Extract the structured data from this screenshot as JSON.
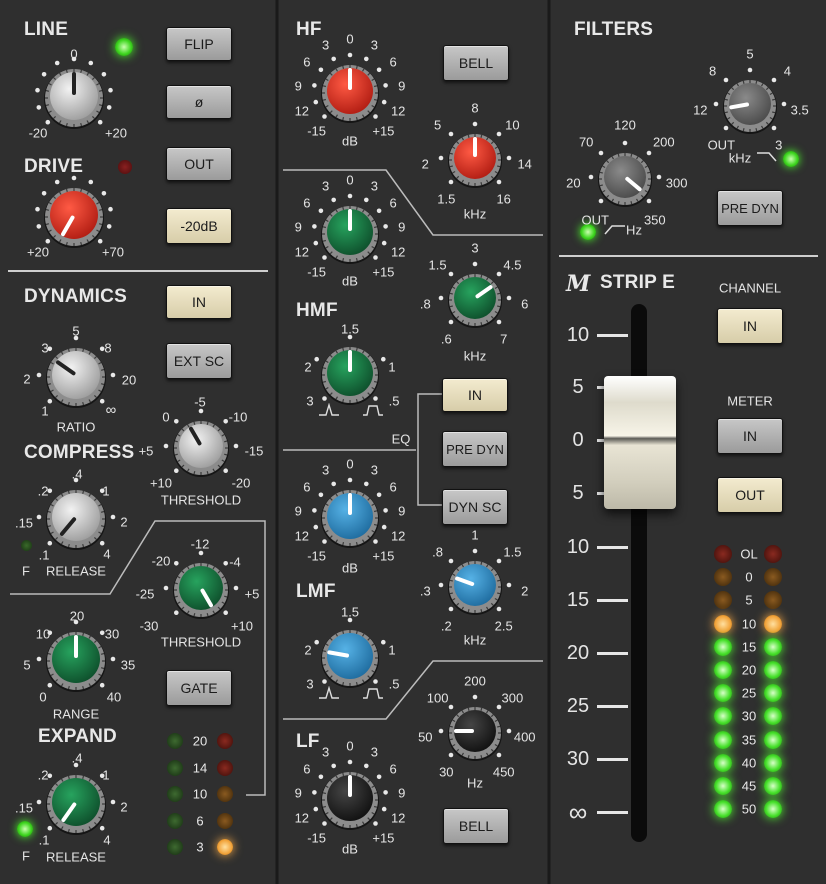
{
  "line": {
    "title": "LINE",
    "buttons": {
      "flip": "FLIP",
      "phase": "ø"
    },
    "knob_scale": {
      "top": "0",
      "left": "-20",
      "right": "+20"
    }
  },
  "drive": {
    "title": "DRIVE",
    "buttons": {
      "out": "OUT",
      "pad": "-20dB"
    },
    "knob_scale": {
      "left": "+20",
      "right": "+70"
    }
  },
  "dynamics": {
    "title": "DYNAMICS",
    "in_button": "IN",
    "ext_sc_button": "EXT SC",
    "ratio": {
      "label": "RATIO",
      "scale": [
        "1",
        "2",
        "3",
        "5",
        "8",
        "20",
        "∞"
      ]
    },
    "compress": {
      "title": "COMPRESS"
    },
    "comp_threshold": {
      "label": "THRESHOLD",
      "scale": [
        "+10",
        "+5",
        "0",
        "-5",
        "-10",
        "-15",
        "-20"
      ]
    },
    "comp_release": {
      "label": "RELEASE",
      "scale": [
        ".1",
        ".15",
        ".2",
        ".4",
        "1",
        "2",
        "4"
      ],
      "fast_label": "F"
    },
    "gate_threshold": {
      "label": "THRESHOLD",
      "scale": [
        "-30",
        "-25",
        "-20",
        "-12",
        "-4",
        "+5",
        "+10"
      ]
    },
    "range": {
      "label": "RANGE",
      "scale": [
        "0",
        "5",
        "10",
        "20",
        "30",
        "35",
        "40"
      ]
    },
    "gate_button": "GATE",
    "expand": {
      "title": "EXPAND"
    },
    "exp_release": {
      "label": "RELEASE",
      "scale": [
        ".1",
        ".15",
        ".2",
        ".4",
        "1",
        "2",
        "4"
      ],
      "fast_label": "F"
    },
    "gr_meter": [
      "20",
      "14",
      "10",
      "6",
      "3"
    ]
  },
  "eq": {
    "hf": {
      "title": "HF",
      "bell_button": "BELL",
      "gain_scale": [
        "-15",
        "12",
        "9",
        "6",
        "3",
        "0",
        "3",
        "6",
        "9",
        "12",
        "+15"
      ],
      "gain_unit": "dB",
      "freq_scale": [
        "1.5",
        "2",
        "5",
        "8",
        "10",
        "14",
        "16"
      ],
      "freq_unit": "kHz"
    },
    "hmf": {
      "title": "HMF",
      "gain_scale": [
        "-15",
        "12",
        "9",
        "6",
        "3",
        "0",
        "3",
        "6",
        "9",
        "12",
        "+15"
      ],
      "gain_unit": "dB",
      "freq_scale": [
        ".6",
        ".8",
        "1.5",
        "3",
        "4.5",
        "6",
        "7"
      ],
      "freq_unit": "kHz",
      "q_scale": [
        "3",
        "2",
        "1.5",
        "1",
        ".5"
      ]
    },
    "center": {
      "in_button": "IN",
      "pre_dyn_button": "PRE DYN",
      "dyn_sc_button": "DYN SC",
      "label": "EQ"
    },
    "lmf": {
      "title": "LMF",
      "gain_scale": [
        "-15",
        "12",
        "9",
        "6",
        "3",
        "0",
        "3",
        "6",
        "9",
        "12",
        "+15"
      ],
      "gain_unit": "dB",
      "freq_scale": [
        ".2",
        ".3",
        ".8",
        "1",
        "1.5",
        "2",
        "2.5"
      ],
      "freq_unit": "kHz",
      "q_scale": [
        "3",
        "2",
        "1.5",
        "1",
        ".5"
      ]
    },
    "lf": {
      "title": "LF",
      "bell_button": "BELL",
      "gain_scale": [
        "-15",
        "12",
        "9",
        "6",
        "3",
        "0",
        "3",
        "6",
        "9",
        "12",
        "+15"
      ],
      "gain_unit": "dB",
      "freq_scale": [
        "30",
        "50",
        "100",
        "200",
        "300",
        "400",
        "450"
      ],
      "freq_unit": "Hz"
    }
  },
  "filters": {
    "title": "FILTERS",
    "lpf_scale": [
      "OUT",
      "12",
      "8",
      "5",
      "4",
      "3.5",
      "3"
    ],
    "lpf_unit": "kHz",
    "hpf_scale": [
      "OUT",
      "20",
      "70",
      "120",
      "200",
      "300",
      "350"
    ],
    "hpf_unit": "Hz",
    "pre_dyn_button": "PRE DYN"
  },
  "strip": {
    "logo": "M",
    "title": "STRIP E",
    "channel_label": "CHANNEL",
    "channel_in_button": "IN",
    "meter_label": "METER",
    "meter_in_button": "IN",
    "meter_out_button": "OUT",
    "fader_scale": [
      "10",
      "5",
      "0",
      "5",
      "10",
      "15",
      "20",
      "25",
      "30",
      "∞"
    ],
    "meter_scale": [
      "OL",
      "0",
      "5",
      "10",
      "15",
      "20",
      "25",
      "30",
      "35",
      "40",
      "45",
      "50"
    ]
  }
}
